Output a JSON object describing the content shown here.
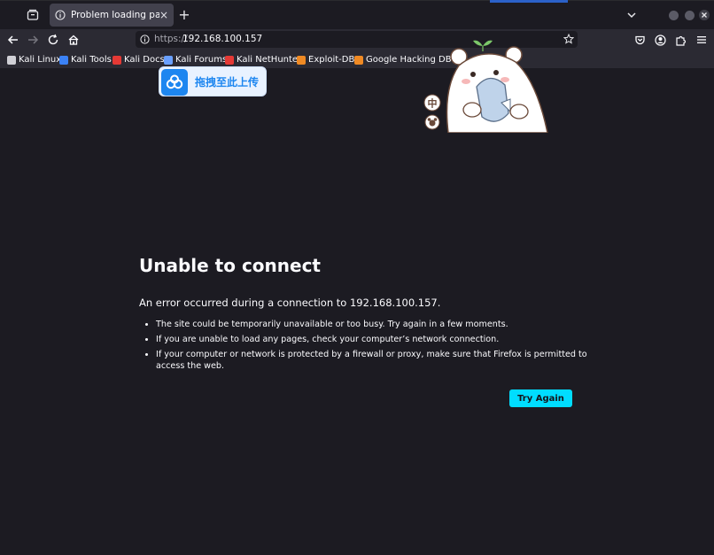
{
  "tab": {
    "title": "Problem loading page",
    "close_glyph": "×",
    "new_tab_glyph": "+"
  },
  "urlbar": {
    "protocol": "https://",
    "host": "192.168.100.157"
  },
  "bookmarks": [
    {
      "label": "Kali Linux",
      "icon": "kali-linux-icon",
      "color": "#d0d0d6"
    },
    {
      "label": "Kali Tools",
      "icon": "kali-tools-icon",
      "color": "#3b82f6"
    },
    {
      "label": "Kali Docs",
      "icon": "kali-docs-icon",
      "color": "#e53935"
    },
    {
      "label": "Kali Forums",
      "icon": "kali-forums-icon",
      "color": "#6aa0ff"
    },
    {
      "label": "Kali NetHunter",
      "icon": "kali-nethunter-icon",
      "color": "#e53935"
    },
    {
      "label": "Exploit-DB",
      "icon": "exploit-db-icon",
      "color": "#f08a24"
    },
    {
      "label": "Google Hacking DB",
      "icon": "ghdb-icon",
      "color": "#f08a24"
    }
  ],
  "overlay": {
    "upload_label": "拖拽至此上传",
    "sticker_badge": "中"
  },
  "error": {
    "title": "Unable to connect",
    "intro": "An error occurred during a connection to 192.168.100.157.",
    "items": [
      "The site could be temporarily unavailable or too busy. Try again in a few moments.",
      "If you are unable to load any pages, check your computer’s network connection.",
      "If your computer or network is protected by a firewall or proxy, make sure that Firefox is permitted to access the web."
    ],
    "try_again_label": "Try Again"
  },
  "colors": {
    "accent": "#00ddff",
    "page_bg": "#1c1b22",
    "toolbar_bg": "#2b2a33",
    "upload_blue": "#1d86f0"
  }
}
